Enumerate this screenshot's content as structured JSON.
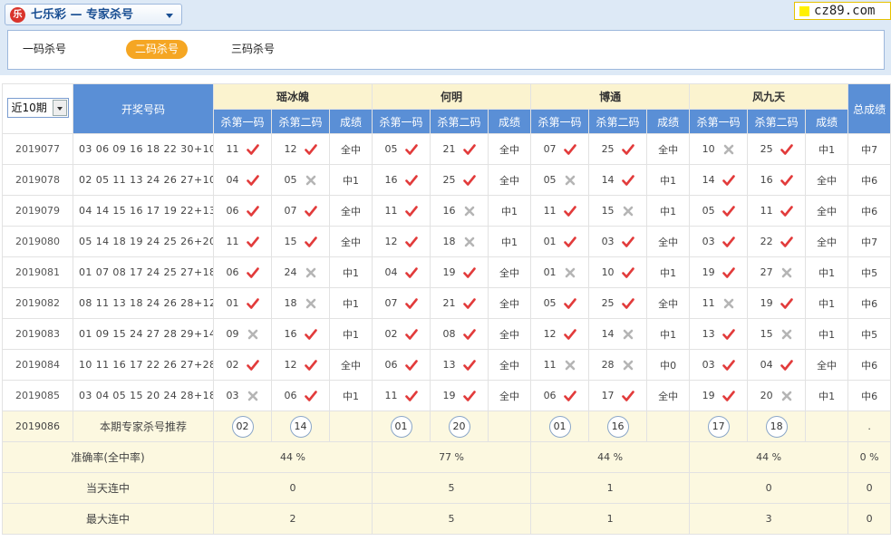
{
  "header": {
    "logo_text": "乐",
    "title": "七乐彩 — 专家杀号",
    "brand": "cz89.com"
  },
  "tabs": [
    {
      "label": "一码杀号",
      "active": false
    },
    {
      "label": "二码杀号",
      "active": true
    },
    {
      "label": "三码杀号",
      "active": false
    }
  ],
  "table": {
    "period_select": "近10期",
    "col_draw": "开奖号码",
    "col_total": "总成绩",
    "sub_headers": [
      "杀第一码",
      "杀第二码",
      "成绩"
    ],
    "experts": [
      "瑶冰魄",
      "何明",
      "博通",
      "风九天"
    ],
    "rows": [
      {
        "period": "2019077",
        "nums": "03 06 09 16 18 22 30+10",
        "e": [
          [
            [
              "11",
              "ok"
            ],
            [
              "12",
              "ok"
            ],
            "全中"
          ],
          [
            [
              "05",
              "ok"
            ],
            [
              "21",
              "ok"
            ],
            "全中"
          ],
          [
            [
              "07",
              "ok"
            ],
            [
              "25",
              "ok"
            ],
            "全中"
          ],
          [
            [
              "10",
              "no"
            ],
            [
              "25",
              "ok"
            ],
            "中1"
          ]
        ],
        "total": "中7"
      },
      {
        "period": "2019078",
        "nums": "02 05 11 13 24 26 27+10",
        "e": [
          [
            [
              "04",
              "ok"
            ],
            [
              "05",
              "no"
            ],
            "中1"
          ],
          [
            [
              "16",
              "ok"
            ],
            [
              "25",
              "ok"
            ],
            "全中"
          ],
          [
            [
              "05",
              "no"
            ],
            [
              "14",
              "ok"
            ],
            "中1"
          ],
          [
            [
              "14",
              "ok"
            ],
            [
              "16",
              "ok"
            ],
            "全中"
          ]
        ],
        "total": "中6"
      },
      {
        "period": "2019079",
        "nums": "04 14 15 16 17 19 22+13",
        "e": [
          [
            [
              "06",
              "ok"
            ],
            [
              "07",
              "ok"
            ],
            "全中"
          ],
          [
            [
              "11",
              "ok"
            ],
            [
              "16",
              "no"
            ],
            "中1"
          ],
          [
            [
              "11",
              "ok"
            ],
            [
              "15",
              "no"
            ],
            "中1"
          ],
          [
            [
              "05",
              "ok"
            ],
            [
              "11",
              "ok"
            ],
            "全中"
          ]
        ],
        "total": "中6"
      },
      {
        "period": "2019080",
        "nums": "05 14 18 19 24 25 26+20",
        "e": [
          [
            [
              "11",
              "ok"
            ],
            [
              "15",
              "ok"
            ],
            "全中"
          ],
          [
            [
              "12",
              "ok"
            ],
            [
              "18",
              "no"
            ],
            "中1"
          ],
          [
            [
              "01",
              "ok"
            ],
            [
              "03",
              "ok"
            ],
            "全中"
          ],
          [
            [
              "03",
              "ok"
            ],
            [
              "22",
              "ok"
            ],
            "全中"
          ]
        ],
        "total": "中7"
      },
      {
        "period": "2019081",
        "nums": "01 07 08 17 24 25 27+18",
        "e": [
          [
            [
              "06",
              "ok"
            ],
            [
              "24",
              "no"
            ],
            "中1"
          ],
          [
            [
              "04",
              "ok"
            ],
            [
              "19",
              "ok"
            ],
            "全中"
          ],
          [
            [
              "01",
              "no"
            ],
            [
              "10",
              "ok"
            ],
            "中1"
          ],
          [
            [
              "19",
              "ok"
            ],
            [
              "27",
              "no"
            ],
            "中1"
          ]
        ],
        "total": "中5"
      },
      {
        "period": "2019082",
        "nums": "08 11 13 18 24 26 28+12",
        "e": [
          [
            [
              "01",
              "ok"
            ],
            [
              "18",
              "no"
            ],
            "中1"
          ],
          [
            [
              "07",
              "ok"
            ],
            [
              "21",
              "ok"
            ],
            "全中"
          ],
          [
            [
              "05",
              "ok"
            ],
            [
              "25",
              "ok"
            ],
            "全中"
          ],
          [
            [
              "11",
              "no"
            ],
            [
              "19",
              "ok"
            ],
            "中1"
          ]
        ],
        "total": "中6"
      },
      {
        "period": "2019083",
        "nums": "01 09 15 24 27 28 29+14",
        "e": [
          [
            [
              "09",
              "no"
            ],
            [
              "16",
              "ok"
            ],
            "中1"
          ],
          [
            [
              "02",
              "ok"
            ],
            [
              "08",
              "ok"
            ],
            "全中"
          ],
          [
            [
              "12",
              "ok"
            ],
            [
              "14",
              "no"
            ],
            "中1"
          ],
          [
            [
              "13",
              "ok"
            ],
            [
              "15",
              "no"
            ],
            "中1"
          ]
        ],
        "total": "中5"
      },
      {
        "period": "2019084",
        "nums": "10 11 16 17 22 26 27+28",
        "e": [
          [
            [
              "02",
              "ok"
            ],
            [
              "12",
              "ok"
            ],
            "全中"
          ],
          [
            [
              "06",
              "ok"
            ],
            [
              "13",
              "ok"
            ],
            "全中"
          ],
          [
            [
              "11",
              "no"
            ],
            [
              "28",
              "no"
            ],
            "中0"
          ],
          [
            [
              "03",
              "ok"
            ],
            [
              "04",
              "ok"
            ],
            "全中"
          ]
        ],
        "total": "中6"
      },
      {
        "period": "2019085",
        "nums": "03 04 05 15 20 24 28+18",
        "e": [
          [
            [
              "03",
              "no"
            ],
            [
              "06",
              "ok"
            ],
            "中1"
          ],
          [
            [
              "11",
              "ok"
            ],
            [
              "19",
              "ok"
            ],
            "全中"
          ],
          [
            [
              "06",
              "ok"
            ],
            [
              "17",
              "ok"
            ],
            "全中"
          ],
          [
            [
              "19",
              "ok"
            ],
            [
              "20",
              "no"
            ],
            "中1"
          ]
        ],
        "total": "中6"
      }
    ],
    "recommend": {
      "period": "2019086",
      "label": "本期专家杀号推荐",
      "picks": [
        [
          "02",
          "14"
        ],
        [
          "01",
          "20"
        ],
        [
          "01",
          "16"
        ],
        [
          "17",
          "18"
        ]
      ],
      "total": "."
    },
    "stats": [
      {
        "label": "准确率(全中率)",
        "values": [
          "44 %",
          "77 %",
          "44 %",
          "44 %"
        ],
        "total": "0 %"
      },
      {
        "label": "当天连中",
        "values": [
          "0",
          "5",
          "1",
          "0"
        ],
        "total": "0"
      },
      {
        "label": "最大连中",
        "values": [
          "2",
          "5",
          "1",
          "3"
        ],
        "total": "0"
      }
    ]
  }
}
